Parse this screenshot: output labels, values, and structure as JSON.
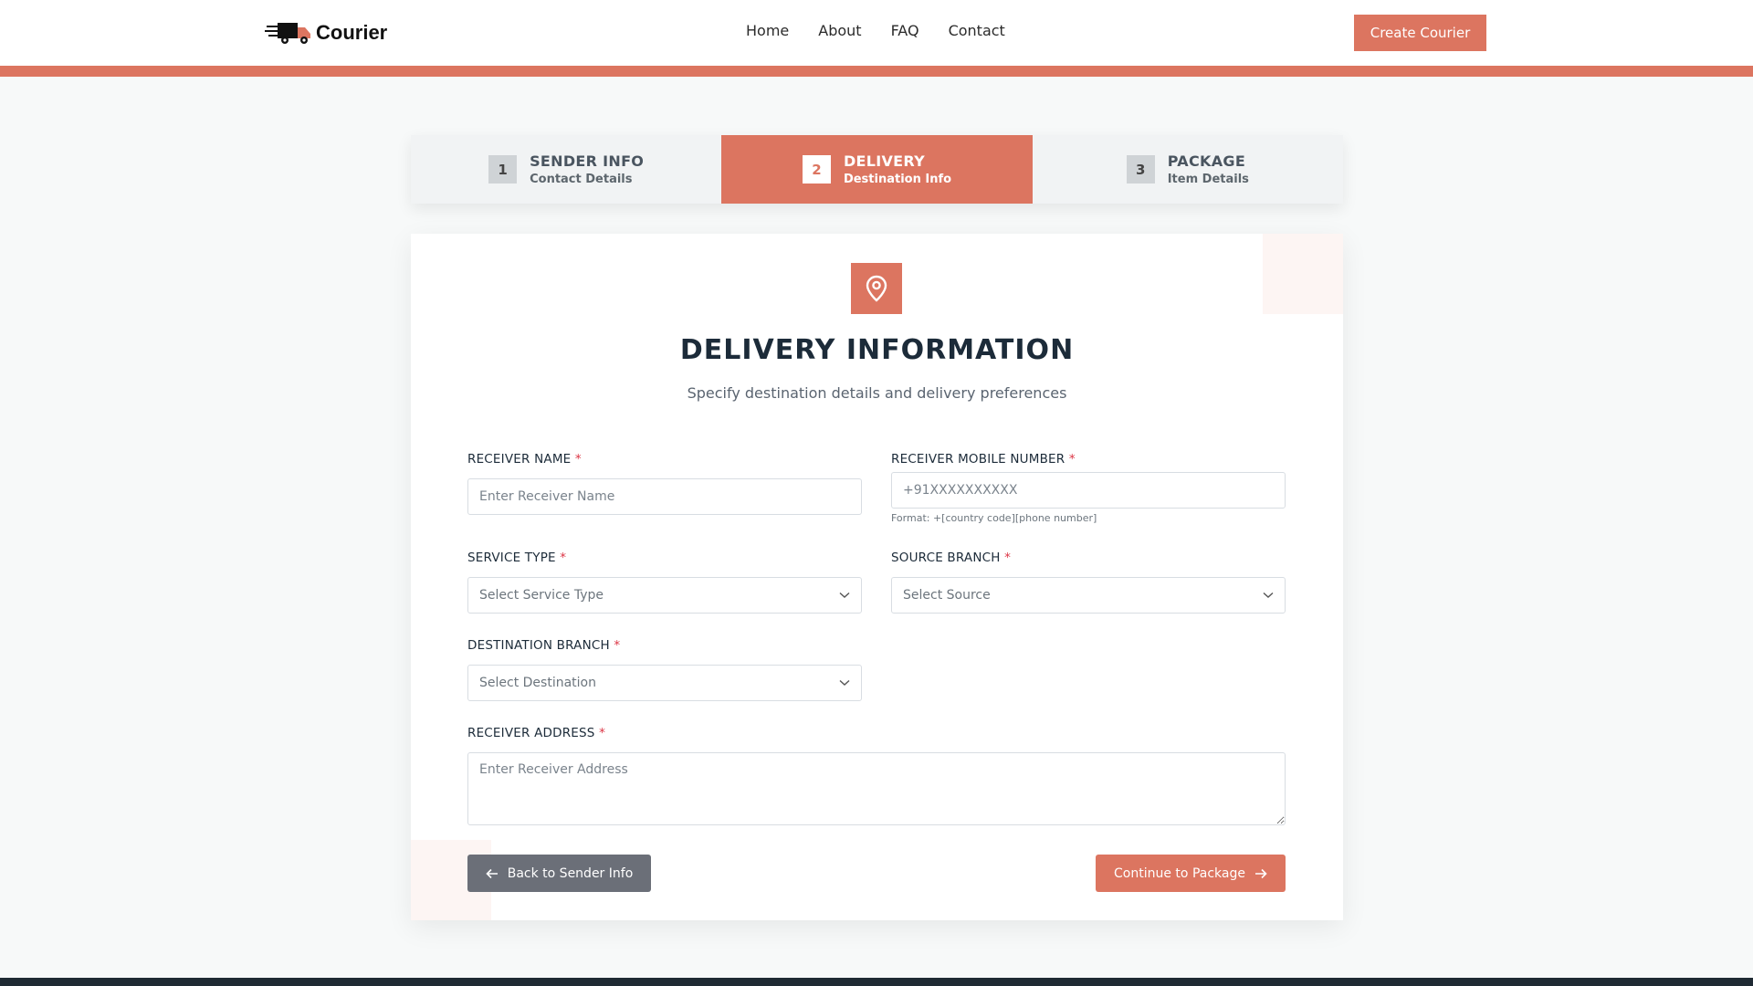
{
  "header": {
    "brand": "Courier",
    "nav": [
      "Home",
      "About",
      "FAQ",
      "Contact"
    ],
    "cta": "Create Courier"
  },
  "colors": {
    "accent": "#dc7560",
    "dark": "#1f2a33",
    "back_button": "#6b6f78",
    "required": "#dc3545"
  },
  "stepper": {
    "active_step": 2,
    "steps": [
      {
        "num": "1",
        "title": "SENDER INFO",
        "sub": "Contact Details"
      },
      {
        "num": "2",
        "title": "DELIVERY",
        "sub": "Destination Info"
      },
      {
        "num": "3",
        "title": "PACKAGE",
        "sub": "Item Details"
      }
    ]
  },
  "card": {
    "icon": "map-pin-icon",
    "title": "DELIVERY INFORMATION",
    "subtitle": "Specify destination details and delivery preferences"
  },
  "form": {
    "receiver_name": {
      "label": "RECEIVER NAME",
      "placeholder": "Enter Receiver Name",
      "value": ""
    },
    "receiver_mobile": {
      "label": "RECEIVER MOBILE NUMBER",
      "placeholder": "+91XXXXXXXXXX",
      "hint": "Format: +[country code][phone number]",
      "value": ""
    },
    "service_type": {
      "label": "SERVICE TYPE",
      "selected": "Select Service Type"
    },
    "source_branch": {
      "label": "SOURCE BRANCH",
      "selected": "Select Source"
    },
    "destination_branch": {
      "label": "DESTINATION BRANCH",
      "selected": "Select Destination"
    },
    "receiver_address": {
      "label": "RECEIVER ADDRESS",
      "placeholder": "Enter Receiver Address",
      "value": ""
    },
    "required_mark": "*"
  },
  "actions": {
    "back": "Back to Sender Info",
    "continue": "Continue to Package"
  }
}
